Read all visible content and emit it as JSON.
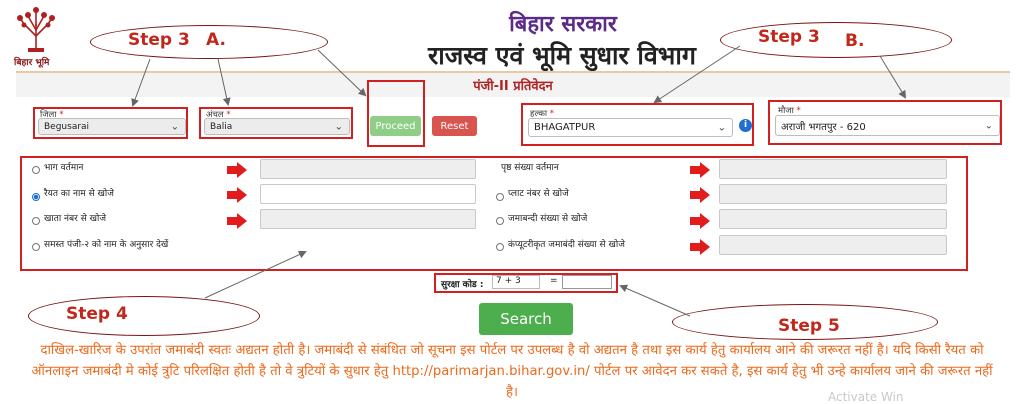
{
  "header": {
    "emblem_text": "बिहार भूमि",
    "gov_title": "बिहार सरकार",
    "dept_title": "राजस्व एवं भूमि सुधार विभाग"
  },
  "annotations": {
    "step3_left": "Step 3",
    "letter_a": "A.",
    "step3_right": "Step 3",
    "letter_b": "B.",
    "step4": "Step 4",
    "step5": "Step 5"
  },
  "page_title": "पंजी-II प्रतिवेदन",
  "filters": {
    "district": {
      "label": "जिला",
      "value": "Begusarai"
    },
    "circle": {
      "label": "अंचल",
      "value": "Balia"
    },
    "halka": {
      "label": "हल्का",
      "value": "BHAGATPUR"
    },
    "mauja": {
      "label": "मौजा",
      "value": "अराजी भगतपुर - 620"
    },
    "required_mark": "*"
  },
  "buttons": {
    "proceed": "Proceed",
    "reset": "Reset",
    "search": "Search"
  },
  "search_options": {
    "left": [
      {
        "label": "भाग वर्तमान",
        "checked": false
      },
      {
        "label": "रैयत का नाम से खोजे",
        "checked": true
      },
      {
        "label": "खाता नंबर से खोजे",
        "checked": false
      },
      {
        "label": "समस्त पंजी-२ को नाम के अनुसार देखें",
        "checked": false
      }
    ],
    "right": [
      {
        "label": "पृष्ठ संख्या वर्तमान",
        "checked": false
      },
      {
        "label": "प्लाट नंबर से खोजे",
        "checked": false
      },
      {
        "label": "जमाबन्दी संख्या से खोजे",
        "checked": false
      },
      {
        "label": "कंप्यूटरीकृत जमाबंदी संख्या से खोजे",
        "checked": false
      }
    ]
  },
  "captcha": {
    "label": "सुरक्षा कोड :",
    "question": "7 + 3",
    "equals": "="
  },
  "notice": "दाखिल-खारिज के उपरांत जमाबंदी स्वतः अद्यतन होती है। जमाबंदी से संबंधित जो सूचना इस पोर्टल पर उपलब्ध है वो अद्यतन है तथा इस कार्य हेतु कार्यालय आने की जरूरत नहीं है। यदि किसी रैयत को ऑनलाइन जमाबंदी मे कोई त्रुटि परिलक्षित होती है तो वे त्रुटियों के सुधार हेतु http://parimarjan.bihar.gov.in/ पोर्टल पर आवेदन कर सकते है, इस कार्य हेतु भी उन्हे कार्यालय जाने की जरूरत नहीं है।",
  "watermark": "Activate Win",
  "colors": {
    "annotation_red": "#c0281c",
    "highlight_red": "#d02020",
    "search_green": "#4cae4c",
    "proceed_green": "#8fce86",
    "reset_red": "#d9534f",
    "notice_orange": "#ec6a1c",
    "gov_title_purple": "#5b2b8a"
  }
}
